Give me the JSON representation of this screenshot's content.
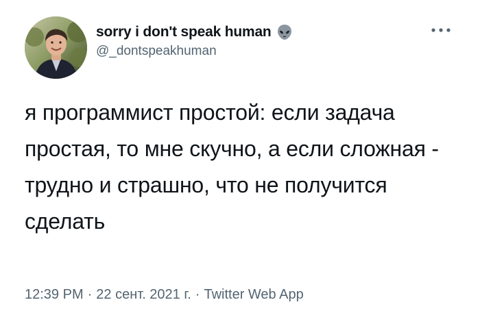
{
  "author": {
    "display_name": "sorry i don't speak human",
    "handle": "@_dontspeakhuman",
    "badge_icon": "alien-icon",
    "avatar_icon": "profile-photo"
  },
  "tweet": {
    "text": "я программист простой: если задача простая, то мне скучно, а если сложная - трудно и страшно, что не получится сделать"
  },
  "meta": {
    "time": "12:39 PM",
    "separator_1": "·",
    "date": "22 сент. 2021 г.",
    "separator_2": "·",
    "source": "Twitter Web App"
  },
  "menu": {
    "more_icon": "more-horizontal-icon"
  },
  "colors": {
    "text_primary": "#0f1419",
    "text_secondary": "#536471"
  }
}
